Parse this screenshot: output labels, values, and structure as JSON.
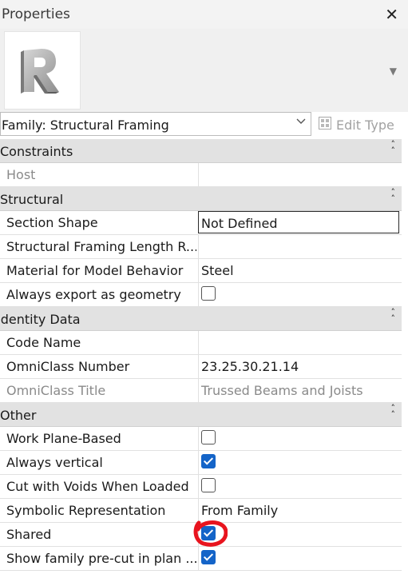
{
  "panel": {
    "title": "Properties",
    "close_icon": "close-icon"
  },
  "type_selector": {
    "thumbnail_icon": "revit-logo-icon",
    "scroll_icon": "chevron-down-icon"
  },
  "family": {
    "value": "Family: Structural Framing",
    "edit_type_label": "Edit Type"
  },
  "sections": [
    {
      "title": "Constraints",
      "properties": [
        {
          "name": "Host",
          "value": "",
          "readonly": true,
          "type": "text"
        }
      ]
    },
    {
      "title": "Structural",
      "properties": [
        {
          "name": "Section Shape",
          "value": "Not Defined",
          "type": "text",
          "active": true
        },
        {
          "name": "Structural Framing Length R...",
          "value": "",
          "type": "text"
        },
        {
          "name": "Material for Model Behavior",
          "value": "Steel",
          "type": "text"
        },
        {
          "name": "Always export as geometry",
          "checked": false,
          "type": "checkbox"
        }
      ]
    },
    {
      "title": "Identity Data",
      "properties": [
        {
          "name": "Code Name",
          "value": "",
          "type": "text"
        },
        {
          "name": "OmniClass Number",
          "value": "23.25.30.21.14",
          "type": "text"
        },
        {
          "name": "OmniClass Title",
          "value": "Trussed Beams and Joists",
          "readonly": true,
          "type": "text"
        }
      ]
    },
    {
      "title": "Other",
      "properties": [
        {
          "name": "Work Plane-Based",
          "checked": false,
          "type": "checkbox"
        },
        {
          "name": "Always vertical",
          "checked": true,
          "type": "checkbox"
        },
        {
          "name": "Cut with Voids When Loaded",
          "checked": false,
          "type": "checkbox"
        },
        {
          "name": "Symbolic Representation",
          "value": "From Family",
          "type": "text"
        },
        {
          "name": "Shared",
          "checked": true,
          "type": "checkbox"
        },
        {
          "name": "Show family pre-cut in plan ...",
          "checked": true,
          "type": "checkbox"
        }
      ]
    }
  ],
  "colors": {
    "checkbox_checked": "#1464c8",
    "annotation": "#e8141e"
  }
}
